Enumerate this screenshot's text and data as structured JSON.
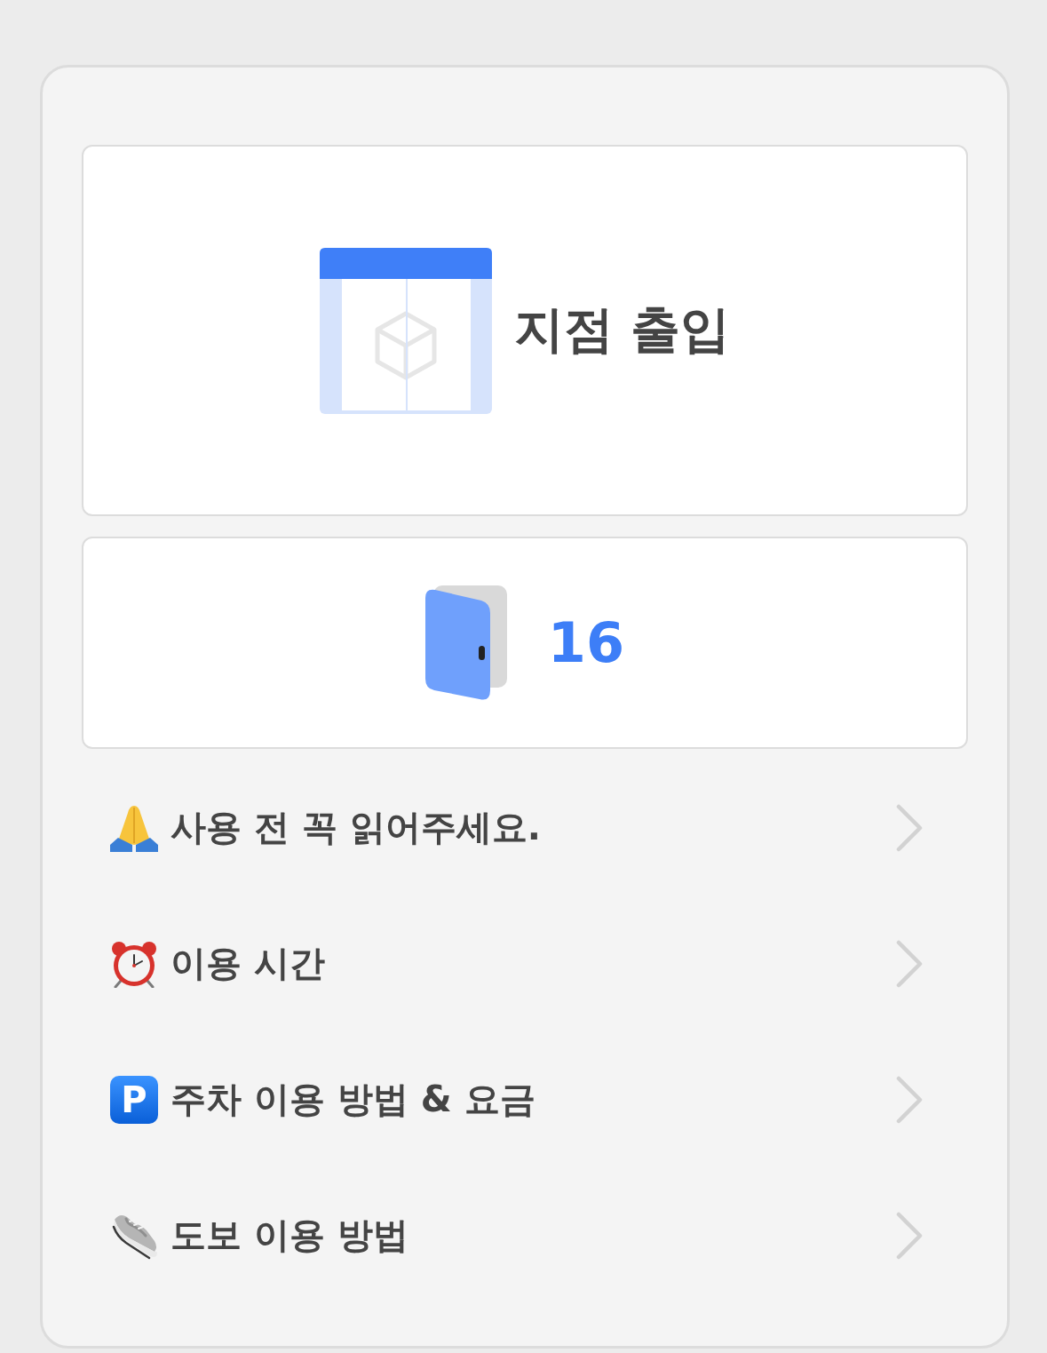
{
  "entrance_card": {
    "label": "지점 출입"
  },
  "door_card": {
    "number": "16"
  },
  "menu": [
    {
      "kind": "pray",
      "label": "사용 전 꼭 읽어주세요."
    },
    {
      "kind": "alarm",
      "label": "이용 시간"
    },
    {
      "kind": "parking",
      "badge": "P",
      "label": "주차 이용 방법 & 요금"
    },
    {
      "kind": "sneaker",
      "label": "도보 이용 방법"
    }
  ]
}
